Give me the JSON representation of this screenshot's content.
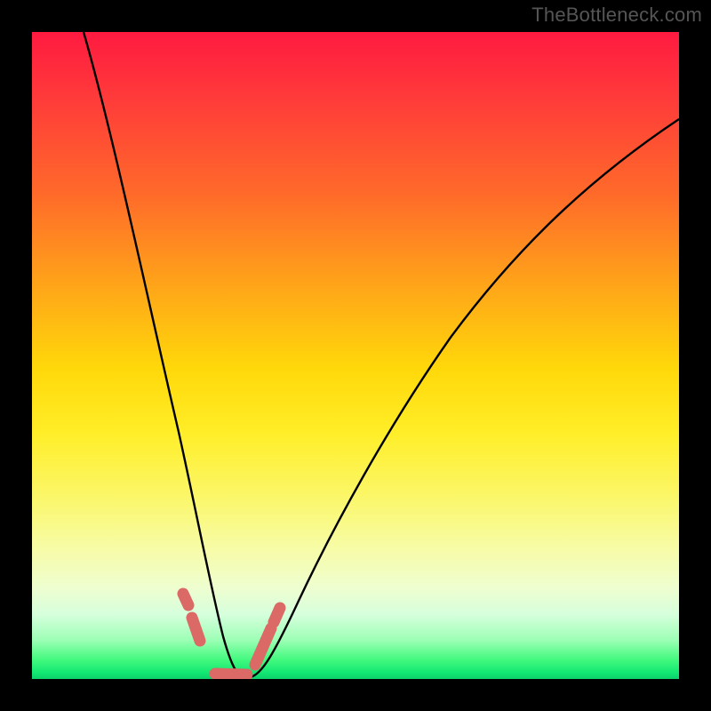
{
  "watermark": "TheBottleneck.com",
  "chart_data": {
    "type": "line",
    "title": "",
    "xlabel": "",
    "ylabel": "",
    "xlim": [
      0,
      1
    ],
    "ylim": [
      0,
      100
    ],
    "background_gradient": {
      "top": "#ff1a40",
      "mid": "#ffd80a",
      "bottom": "#0ccf6a"
    },
    "series": [
      {
        "name": "bottleneck-curve",
        "color": "#000000",
        "x": [
          0.08,
          0.12,
          0.16,
          0.2,
          0.24,
          0.27,
          0.29,
          0.3,
          0.32,
          0.35,
          0.4,
          0.5,
          0.6,
          0.7,
          0.8,
          0.9,
          1.0
        ],
        "values": [
          100,
          78,
          56,
          36,
          18,
          6,
          1,
          0,
          0,
          2,
          10,
          28,
          45,
          58,
          69,
          78,
          86
        ]
      },
      {
        "name": "marker-band-left",
        "color": "#db6a66",
        "x": [
          0.233,
          0.237,
          0.247,
          0.255
        ],
        "values": [
          13,
          12,
          9,
          6
        ]
      },
      {
        "name": "marker-band-bottom",
        "color": "#db6a66",
        "x": [
          0.28,
          0.29,
          0.3,
          0.31,
          0.32,
          0.33
        ],
        "values": [
          0.5,
          0.3,
          0.3,
          0.3,
          0.3,
          0.5
        ]
      },
      {
        "name": "marker-band-right",
        "color": "#db6a66",
        "x": [
          0.343,
          0.353,
          0.363,
          0.373,
          0.38
        ],
        "values": [
          2.5,
          4.2,
          6.0,
          8.0,
          9.5
        ]
      }
    ]
  }
}
